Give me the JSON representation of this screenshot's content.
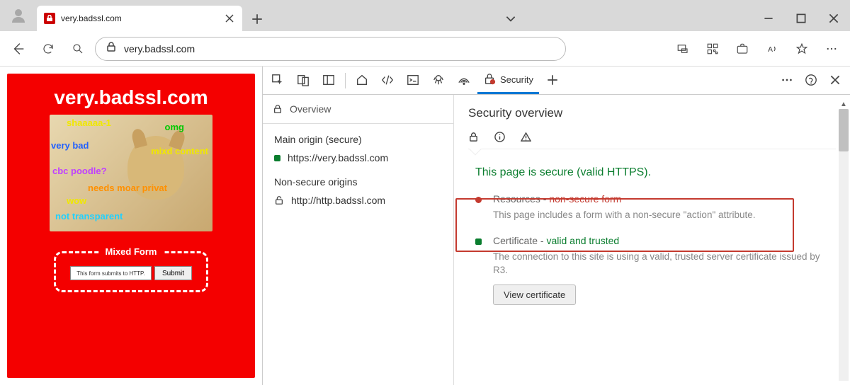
{
  "tab": {
    "title": "very.badssl.com"
  },
  "toolbar": {
    "url": "very.badssl.com"
  },
  "page": {
    "heading": "very.badssl.com",
    "doge_labels": {
      "sha": "shaaaaa-1",
      "omg": "omg",
      "verybad": "very bad",
      "mixd": "mixd content",
      "cbc": "cbc poodle?",
      "moar": "needs moar privat",
      "wow": "wow",
      "transp": "not transparent"
    },
    "mixed": {
      "legend": "Mixed Form",
      "placeholder": "This form submits to HTTP.",
      "submit": "Submit"
    }
  },
  "devtools": {
    "tabs": {
      "security": "Security"
    },
    "overview": "Overview",
    "main_origin_label": "Main origin (secure)",
    "main_origin": "https://very.badssl.com",
    "nonsecure_label": "Non-secure origins",
    "nonsecure_origin": "http://http.badssl.com",
    "so_title": "Security overview",
    "secure_msg": "This page is secure (valid HTTPS).",
    "res_label": "Resources - ",
    "res_status": "non-secure form",
    "res_desc": "This page includes a form with a non-secure \"action\" attribute.",
    "cert_label": "Certificate - ",
    "cert_status": "valid and trusted",
    "cert_desc": "The connection to this site is using a valid, trusted server certificate issued by R3.",
    "view_cert": "View certificate"
  }
}
